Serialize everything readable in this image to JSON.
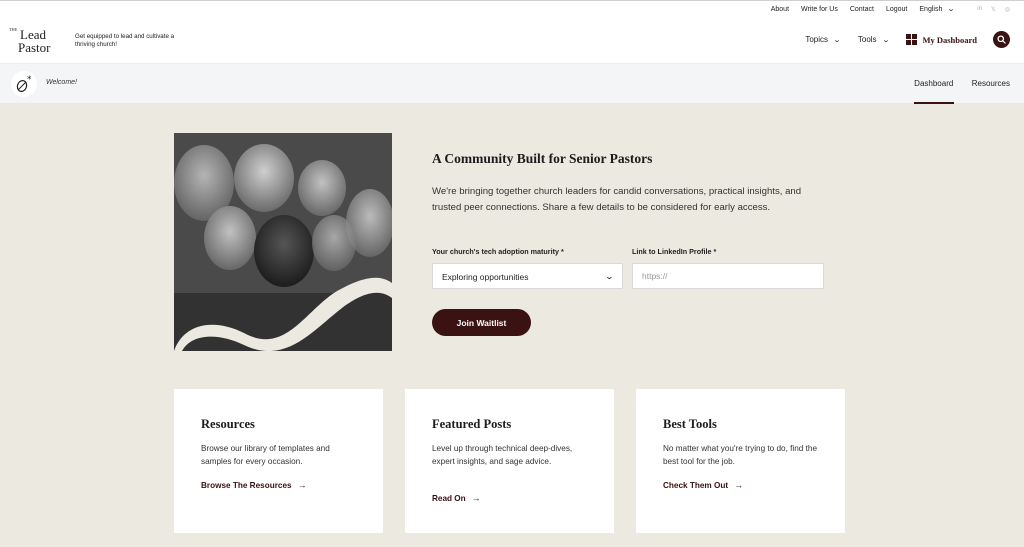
{
  "utility": {
    "links": [
      "About",
      "Write for Us",
      "Contact",
      "Logout"
    ],
    "language": "English",
    "social": [
      "in",
      "𝕏",
      "◎"
    ]
  },
  "header": {
    "logo": {
      "the": "THE",
      "line1": "Lead",
      "line2": "Pastor"
    },
    "tagline": "Get equipped to lead and cultivate a thriving church!",
    "nav": {
      "topics": "Topics",
      "tools": "Tools",
      "dashboard": "My Dashboard"
    }
  },
  "subnav": {
    "welcome": "Welcome!",
    "tabs": [
      "Dashboard",
      "Resources"
    ]
  },
  "hero": {
    "title": "A Community Built for Senior Pastors",
    "description": "We're bringing together church leaders for candid conversations, practical insights, and trusted peer connections. Share a few details to be considered for early access.",
    "tech_label": "Your church's tech adoption maturity *",
    "tech_value": "Exploring opportunities",
    "linkedin_label": "Link to LinkedIn Profile *",
    "linkedin_placeholder": "https://",
    "button": "Join Waitlist"
  },
  "cards": [
    {
      "title": "Resources",
      "text": "Browse our library of templates and samples for every occasion.",
      "cta": "Browse The Resources"
    },
    {
      "title": "Featured Posts",
      "text": "Level up through technical deep-dives, expert insights, and sage advice.",
      "cta": "Read On"
    },
    {
      "title": "Best Tools",
      "text": "No matter what you're trying to do, find the best tool for the job.",
      "cta": "Check Them Out"
    }
  ],
  "colors": {
    "brand": "#3a1212",
    "main_bg": "#ece9e1",
    "subnav_bg": "#f4f5f7"
  }
}
